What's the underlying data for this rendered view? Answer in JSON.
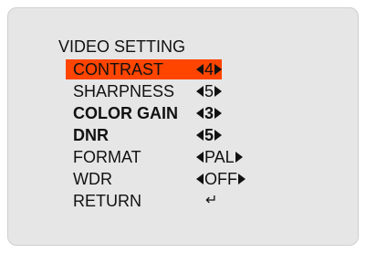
{
  "menu": {
    "title": "VIDEO SETTING",
    "accent_color": "#ff4500",
    "background_color": "#e6e6e6",
    "items": [
      {
        "label": "CONTRAST",
        "value": "4",
        "selected": true
      },
      {
        "label": "SHARPNESS",
        "value": "5",
        "selected": false
      },
      {
        "label": "COLOR GAIN",
        "value": "3",
        "selected": false
      },
      {
        "label": "DNR",
        "value": "5",
        "selected": false
      },
      {
        "label": "FORMAT",
        "value": "PAL",
        "selected": false
      },
      {
        "label": "WDR",
        "value": "OFF",
        "selected": false
      },
      {
        "label": "RETURN",
        "value_icon": "return-arrow-icon",
        "selected": false
      }
    ]
  }
}
